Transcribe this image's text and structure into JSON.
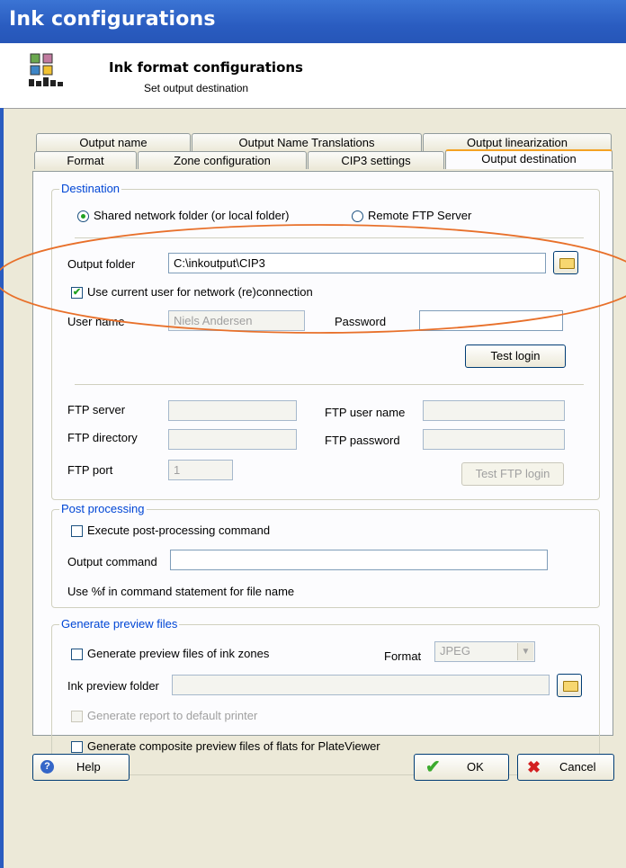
{
  "window": {
    "title": "Ink configurations"
  },
  "header": {
    "title": "Ink format configurations",
    "subtitle": "Set output destination"
  },
  "tabs_row1": [
    "Output name",
    "Output Name Translations",
    "Output linearization"
  ],
  "tabs_row2": [
    "Format",
    "Zone configuration",
    "CIP3 settings",
    "Output destination"
  ],
  "active_tab": "Output destination",
  "destination": {
    "group_title": "Destination",
    "radio_shared": "Shared network folder (or local folder)",
    "radio_ftp": "Remote FTP Server",
    "selected": "shared",
    "output_folder_label": "Output folder",
    "output_folder_value": "C:\\inkoutput\\CIP3",
    "use_current_user_label": "Use current user for network (re)connection",
    "use_current_user_checked": true,
    "user_name_label": "User name",
    "user_name_value": "Niels Andersen",
    "password_label": "Password",
    "password_value": "",
    "test_login_label": "Test login",
    "ftp_server_label": "FTP server",
    "ftp_server_value": "",
    "ftp_user_label": "FTP user name",
    "ftp_user_value": "",
    "ftp_directory_label": "FTP directory",
    "ftp_directory_value": "",
    "ftp_password_label": "FTP password",
    "ftp_password_value": "",
    "ftp_port_label": "FTP port",
    "ftp_port_value": "1",
    "test_ftp_login_label": "Test FTP login"
  },
  "post_processing": {
    "group_title": "Post processing",
    "execute_label": "Execute post-processing command",
    "output_command_label": "Output command",
    "output_command_value": "",
    "hint": "Use %f in command statement for file name"
  },
  "preview": {
    "group_title": "Generate preview files",
    "generate_label": "Generate preview files of ink zones",
    "format_label": "Format",
    "format_value": "JPEG",
    "ink_preview_folder_label": "Ink preview folder",
    "ink_preview_folder_value": "",
    "report_label": "Generate report to default printer",
    "composite_label": "Generate composite preview files of flats for PlateViewer"
  },
  "footer": {
    "help_label": "Help",
    "ok_label": "OK",
    "cancel_label": "Cancel"
  },
  "colors": {
    "title_bar": "#2a5cc0",
    "group_title": "#0046d5",
    "annotation": "#e8702a",
    "active_tab_accent": "#f4a224"
  }
}
